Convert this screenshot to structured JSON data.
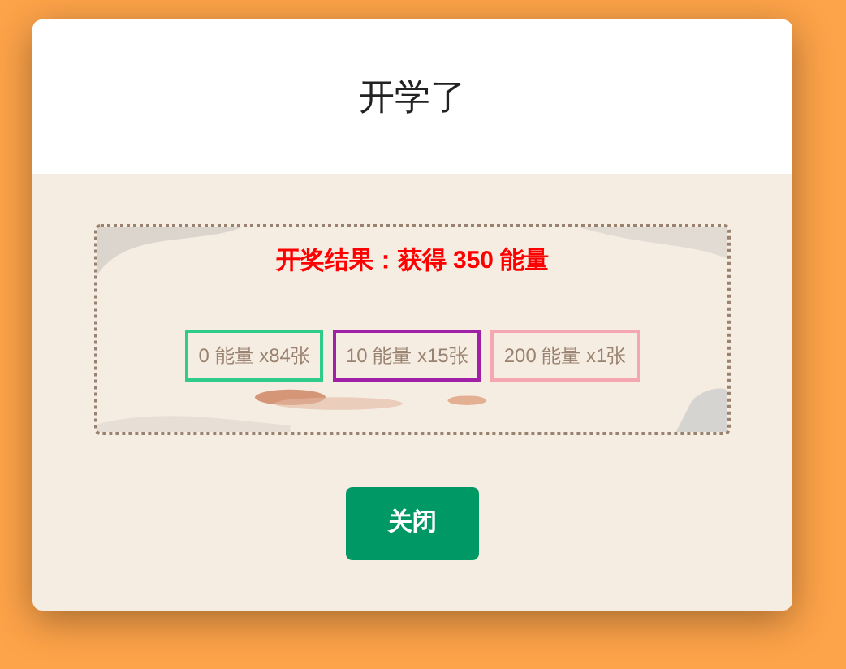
{
  "dialog": {
    "title": "开学了",
    "result": "开奖结果：获得 350 能量",
    "prizes": [
      {
        "label": "0 能量 x84张",
        "color": "#2ecc8a"
      },
      {
        "label": "10 能量 x15张",
        "color": "#a020a8"
      },
      {
        "label": "200 能量 x1张",
        "color": "#f4a7b0"
      }
    ],
    "close_button": "关闭"
  }
}
